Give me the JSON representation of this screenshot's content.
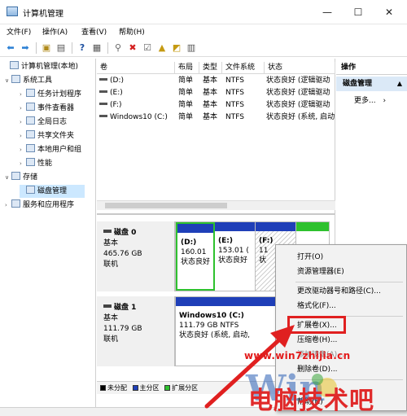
{
  "window": {
    "title": "计算机管理",
    "minimize": "—",
    "maximize": "☐",
    "close": "✕"
  },
  "menu": [
    "文件(F)",
    "操作(A)",
    "查看(V)",
    "帮助(H)"
  ],
  "tree": {
    "items": [
      {
        "label": "计算机管理(本地)",
        "twisty": "",
        "indent": 0
      },
      {
        "label": "系统工具",
        "twisty": "∨",
        "indent": 1
      },
      {
        "label": "任务计划程序",
        "twisty": "›",
        "indent": 2
      },
      {
        "label": "事件查看器",
        "twisty": "›",
        "indent": 2
      },
      {
        "label": "全局日志",
        "twisty": "›",
        "indent": 2
      },
      {
        "label": "共享文件夹",
        "twisty": "›",
        "indent": 2
      },
      {
        "label": "本地用户和组",
        "twisty": "›",
        "indent": 2
      },
      {
        "label": "性能",
        "twisty": "›",
        "indent": 2
      },
      {
        "label": "存储",
        "twisty": "∨",
        "indent": 1
      },
      {
        "label": "磁盘管理",
        "twisty": "",
        "indent": 2,
        "selected": true
      },
      {
        "label": "服务和应用程序",
        "twisty": "›",
        "indent": 1
      }
    ]
  },
  "volumes": {
    "headers": [
      "卷",
      "布局",
      "类型",
      "文件系统",
      "状态"
    ],
    "rows": [
      {
        "name": "(D:)",
        "layout": "简单",
        "type": "基本",
        "fs": "NTFS",
        "status": "状态良好 (逻辑驱动"
      },
      {
        "name": "(E:)",
        "layout": "简单",
        "type": "基本",
        "fs": "NTFS",
        "status": "状态良好 (逻辑驱动"
      },
      {
        "name": "(F:)",
        "layout": "简单",
        "type": "基本",
        "fs": "NTFS",
        "status": "状态良好 (逻辑驱动"
      },
      {
        "name": "Windows10 (C:)",
        "layout": "简单",
        "type": "基本",
        "fs": "NTFS",
        "status": "状态良好 (系统, 启动"
      }
    ]
  },
  "disks": [
    {
      "name": "磁盘 0",
      "kind": "基本",
      "size": "465.76 GB",
      "state": "联机",
      "partitions": [
        {
          "title": "(D:)",
          "line1": "160.01",
          "line2": "状态良好"
        },
        {
          "title": "(E:)",
          "line1": "153.01 (",
          "line2": "状态良好"
        },
        {
          "title": "(F:)",
          "line1": "11",
          "line2": "状"
        },
        {
          "title": "",
          "line1": "",
          "line2": ""
        }
      ]
    },
    {
      "name": "磁盘 1",
      "kind": "基本",
      "size": "111.79 GB",
      "state": "联机",
      "partitions": [
        {
          "title": "Windows10  (C:)",
          "line1": "111.79 GB NTFS",
          "line2": "状态良好 (系统, 启动,"
        }
      ]
    }
  ],
  "legend": [
    "未分配",
    "主分区",
    "扩展分区"
  ],
  "colors": {
    "unallocated": "#000000",
    "primary": "#1f3fb8",
    "extended": "#2ec12e",
    "highlight": "#e02020"
  },
  "actions": {
    "header": "操作",
    "subheader": "磁盘管理",
    "more": "更多..."
  },
  "context_menu": {
    "items": [
      {
        "label": "打开(O)",
        "enabled": true
      },
      {
        "label": "资源管理器(E)",
        "enabled": true
      },
      {
        "label": "更改驱动器号和路径(C)...",
        "enabled": true
      },
      {
        "label": "格式化(F)...",
        "enabled": true
      },
      {
        "label": "扩展卷(X)...",
        "enabled": true
      },
      {
        "label": "压缩卷(H)...",
        "enabled": true
      },
      {
        "label": "添加镜像(A)...",
        "enabled": false
      },
      {
        "label": "删除卷(D)...",
        "enabled": true
      },
      {
        "label": "帮助(H)",
        "enabled": true
      }
    ]
  },
  "watermark": {
    "url": "www.win7zhijia.cn",
    "brand": "电脑技术吧"
  }
}
